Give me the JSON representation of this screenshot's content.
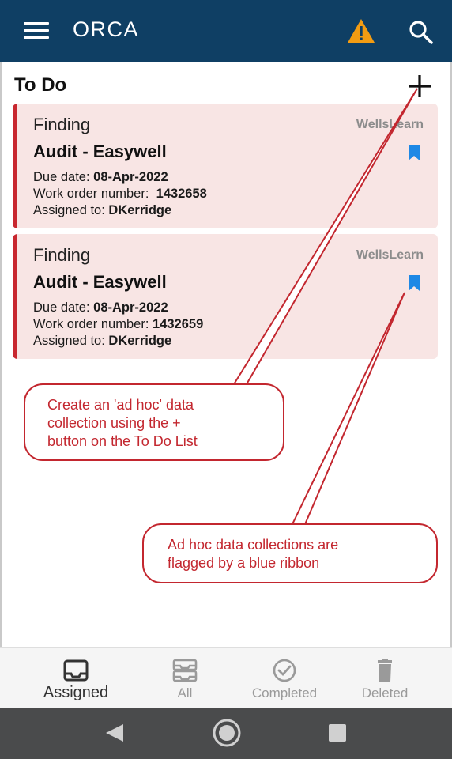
{
  "app": {
    "title": "ORCA",
    "menu_icon": "hamburger-menu-icon",
    "warning_icon": "warning-triangle-icon",
    "search_icon": "search-icon"
  },
  "todo": {
    "title": "To Do",
    "add_icon": "plus-icon",
    "cards": [
      {
        "type": "Finding",
        "source": "WellsLearn",
        "title": "Audit - Easywell",
        "due_label": "Due date:",
        "due_value": "08-Apr-2022",
        "wo_label": "Work order number:",
        "wo_value": "1432658",
        "assigned_label": "Assigned to:",
        "assigned_value": "DKerridge",
        "flag_icon": "bookmark-ribbon-icon"
      },
      {
        "type": "Finding",
        "source": "WellsLearn",
        "title": "Audit - Easywell",
        "due_label": "Due date:",
        "due_value": "08-Apr-2022",
        "wo_label": "Work order number:",
        "wo_value": "1432659",
        "assigned_label": "Assigned to:",
        "assigned_value": "DKerridge",
        "flag_icon": "bookmark-ribbon-icon"
      }
    ]
  },
  "annotations": {
    "callout_1": [
      "Create an 'ad hoc' data",
      "collection using the +",
      "button on the To Do List"
    ],
    "callout_2": [
      "Ad hoc data collections are",
      "flagged by a blue ribbon"
    ]
  },
  "tabs": [
    {
      "label": "Assigned",
      "icon": "inbox-icon",
      "active": true
    },
    {
      "label": "All",
      "icon": "inbox-stack-icon",
      "active": false
    },
    {
      "label": "Completed",
      "icon": "check-circle-icon",
      "active": false
    },
    {
      "label": "Deleted",
      "icon": "trash-icon",
      "active": false
    }
  ],
  "colors": {
    "appbar": "#0f3f64",
    "card_bg": "#f8e5e4",
    "card_accent": "#c8272f",
    "ribbon": "#1e88e5",
    "warning": "#f39c12",
    "callout": "#c3272f"
  }
}
